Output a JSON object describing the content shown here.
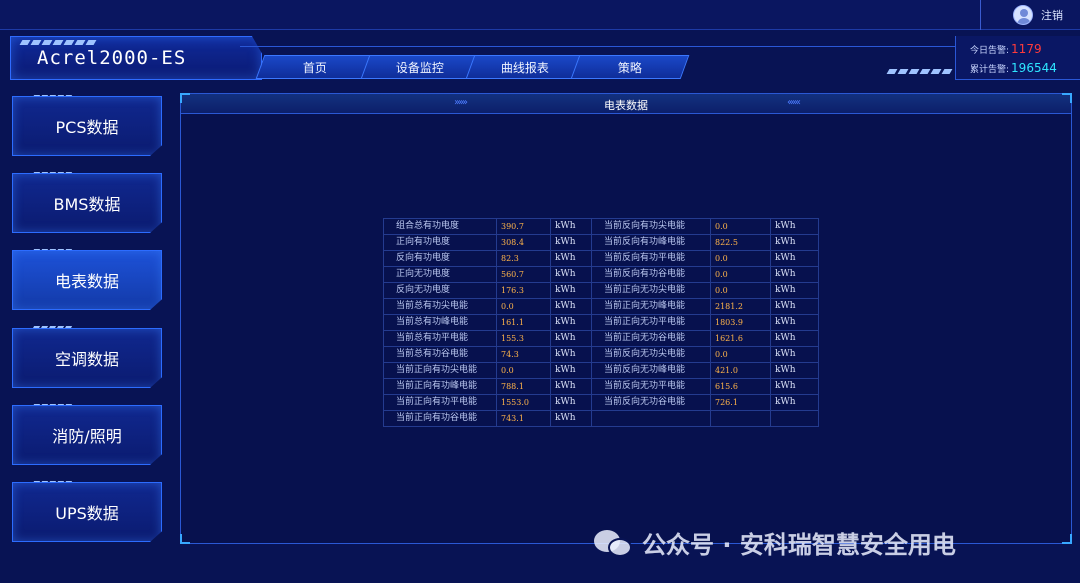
{
  "topbar": {
    "logout_label": "注销"
  },
  "header": {
    "app_title": "Acrel2000-ES",
    "nav_tabs": [
      {
        "label": "首页"
      },
      {
        "label": "设备监控"
      },
      {
        "label": "曲线报表"
      },
      {
        "label": "策略"
      }
    ]
  },
  "alarms": {
    "today_label": "今日告警:",
    "today_value": "1179",
    "total_label": "累计告警:",
    "total_value": "196544"
  },
  "sidebar": {
    "items": [
      {
        "label": "PCS数据"
      },
      {
        "label": "BMS数据"
      },
      {
        "label": "电表数据",
        "active": true
      },
      {
        "label": "空调数据"
      },
      {
        "label": "消防/照明"
      },
      {
        "label": "UPS数据"
      }
    ]
  },
  "panel": {
    "title": "电表数据",
    "left_chevrons": "››››››",
    "right_chevrons": "‹‹‹‹‹‹"
  },
  "meter": {
    "unit": "kWh",
    "rows": [
      [
        "组合总有功电度",
        "390.7",
        "kWh",
        "当前反向有功尖电能",
        "0.0",
        "kWh"
      ],
      [
        "正向有功电度",
        "308.4",
        "kWh",
        "当前反向有功峰电能",
        "822.5",
        "kWh"
      ],
      [
        "反向有功电度",
        "82.3",
        "kWh",
        "当前反向有功平电能",
        "0.0",
        "kWh"
      ],
      [
        "正向无功电度",
        "560.7",
        "kWh",
        "当前反向有功谷电能",
        "0.0",
        "kWh"
      ],
      [
        "反向无功电度",
        "176.3",
        "kWh",
        "当前正向无功尖电能",
        "0.0",
        "kWh"
      ],
      [
        "当前总有功尖电能",
        "0.0",
        "kWh",
        "当前正向无功峰电能",
        "2181.2",
        "kWh"
      ],
      [
        "当前总有功峰电能",
        "161.1",
        "kWh",
        "当前正向无功平电能",
        "1803.9",
        "kWh"
      ],
      [
        "当前总有功平电能",
        "155.3",
        "kWh",
        "当前正向无功谷电能",
        "1621.6",
        "kWh"
      ],
      [
        "当前总有功谷电能",
        "74.3",
        "kWh",
        "当前反向无功尖电能",
        "0.0",
        "kWh"
      ],
      [
        "当前正向有功尖电能",
        "0.0",
        "kWh",
        "当前反向无功峰电能",
        "421.0",
        "kWh"
      ],
      [
        "当前正向有功峰电能",
        "788.1",
        "kWh",
        "当前反向无功平电能",
        "615.6",
        "kWh"
      ],
      [
        "当前正向有功平电能",
        "1553.0",
        "kWh",
        "当前反向无功谷电能",
        "726.1",
        "kWh"
      ],
      [
        "当前正向有功谷电能",
        "743.1",
        "kWh",
        "",
        "",
        ""
      ]
    ]
  },
  "watermark": {
    "text": "公众号 · 安科瑞智慧安全用电"
  }
}
